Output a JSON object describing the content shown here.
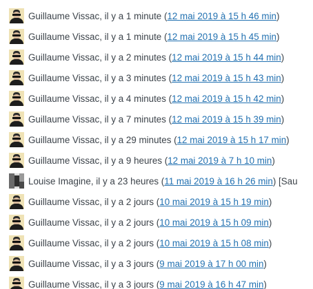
{
  "entries": [
    {
      "author": "Guillaume Vissac",
      "ago": ", il y a 1 minute (",
      "date": "12 mai 2019 à 15 h 46 min",
      "after": ")",
      "avatar": "guillaume-avatar-icon"
    },
    {
      "author": "Guillaume Vissac",
      "ago": ", il y a 1 minute (",
      "date": "12 mai 2019 à 15 h 45 min",
      "after": ")",
      "avatar": "guillaume-avatar-icon"
    },
    {
      "author": "Guillaume Vissac",
      "ago": ", il y a 2 minutes (",
      "date": "12 mai 2019 à 15 h 44 min",
      "after": ")",
      "avatar": "guillaume-avatar-icon"
    },
    {
      "author": "Guillaume Vissac",
      "ago": ", il y a 3 minutes (",
      "date": "12 mai 2019 à 15 h 43 min",
      "after": ")",
      "avatar": "guillaume-avatar-icon"
    },
    {
      "author": "Guillaume Vissac",
      "ago": ", il y a 4 minutes (",
      "date": "12 mai 2019 à 15 h 42 min",
      "after": ")",
      "avatar": "guillaume-avatar-icon"
    },
    {
      "author": "Guillaume Vissac",
      "ago": ", il y a 7 minutes (",
      "date": "12 mai 2019 à 15 h 39 min",
      "after": ")",
      "avatar": "guillaume-avatar-icon"
    },
    {
      "author": "Guillaume Vissac",
      "ago": ", il y a 29 minutes (",
      "date": "12 mai 2019 à 15 h 17 min",
      "after": ")",
      "avatar": "guillaume-avatar-icon"
    },
    {
      "author": "Guillaume Vissac",
      "ago": ", il y a 9 heures (",
      "date": "12 mai 2019 à 7 h 10 min",
      "after": ")",
      "avatar": "guillaume-avatar-icon"
    },
    {
      "author": "Louise Imagine",
      "ago": ", il y a 23 heures (",
      "date": "11 mai 2019 à 16 h 26 min",
      "after": ") [Sau",
      "avatar": "louise-avatar-icon"
    },
    {
      "author": "Guillaume Vissac",
      "ago": ", il y a 2 jours (",
      "date": "10 mai 2019 à 15 h 19 min",
      "after": ")",
      "avatar": "guillaume-avatar-icon"
    },
    {
      "author": "Guillaume Vissac",
      "ago": ", il y a 2 jours (",
      "date": "10 mai 2019 à 15 h 09 min",
      "after": ")",
      "avatar": "guillaume-avatar-icon"
    },
    {
      "author": "Guillaume Vissac",
      "ago": ", il y a 2 jours (",
      "date": "10 mai 2019 à 15 h 08 min",
      "after": ")",
      "avatar": "guillaume-avatar-icon"
    },
    {
      "author": "Guillaume Vissac",
      "ago": ", il y a 3 jours (",
      "date": "9 mai 2019 à 17 h 00 min",
      "after": ")",
      "avatar": "guillaume-avatar-icon"
    },
    {
      "author": "Guillaume Vissac",
      "ago": ", il y a 3 jours (",
      "date": "9 mai 2019 à 16 h 47 min",
      "after": ")",
      "avatar": "guillaume-avatar-icon"
    }
  ],
  "colors": {
    "text": "#3c434a",
    "link": "#2271b1"
  }
}
